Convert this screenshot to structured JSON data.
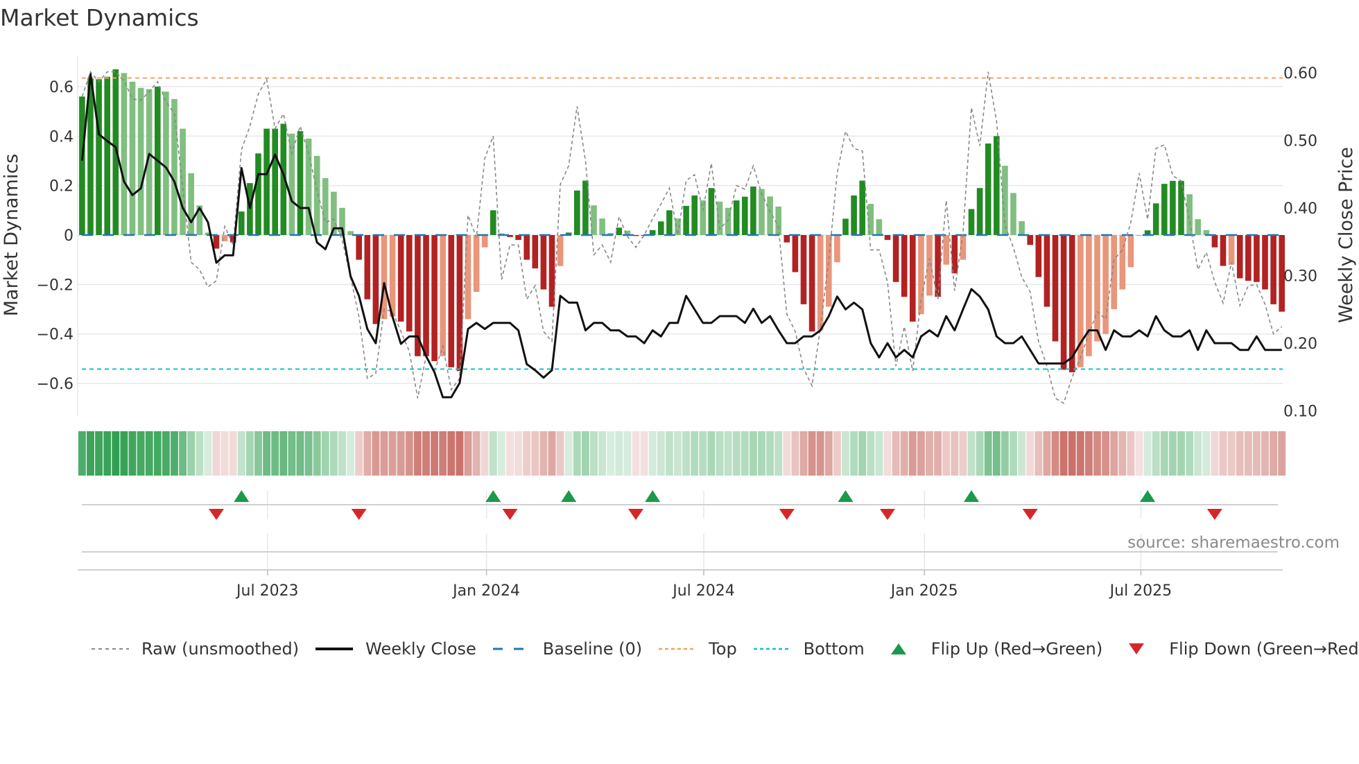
{
  "title": "Market Dynamics",
  "source": "source: sharemaestro.com",
  "colors": {
    "bar_green_strong": "#228b22",
    "bar_green_weak": "#80bf80",
    "bar_red_strong": "#b22222",
    "bar_red_weak": "#e9967a",
    "close": "#111111",
    "raw": "#888888",
    "baseline": "#1f77b4",
    "top": "#f4a261",
    "bottom": "#17becf",
    "flip_up": "#1a9a4a",
    "flip_down": "#d62728",
    "strip_green": "#2e9e4f",
    "strip_red": "#c0574e"
  },
  "legend": [
    {
      "key": "raw",
      "label": "Raw (unsmoothed)"
    },
    {
      "key": "close",
      "label": "Weekly Close"
    },
    {
      "key": "baseline",
      "label": "Baseline (0)"
    },
    {
      "key": "top",
      "label": "Top"
    },
    {
      "key": "bottom",
      "label": "Bottom"
    },
    {
      "key": "flip_up",
      "label": "Flip Up (Red→Green)"
    },
    {
      "key": "flip_down",
      "label": "Flip Down (Green→Red)"
    }
  ],
  "chart_data": {
    "type": "bar",
    "title": "Market Dynamics",
    "ylabel": "Market Dynamics",
    "ylabel_right": "Weekly Close Price",
    "x_unit": "week index",
    "ylim": [
      -0.75,
      0.72
    ],
    "ylim_right": [
      0.088,
      0.633
    ],
    "yticks": [
      {
        "v": -0.6,
        "label": "−0.6"
      },
      {
        "v": -0.4,
        "label": "−0.4"
      },
      {
        "v": -0.2,
        "label": "−0.2"
      },
      {
        "v": 0,
        "label": "0"
      },
      {
        "v": 0.2,
        "label": "0.2"
      },
      {
        "v": 0.4,
        "label": "0.4"
      },
      {
        "v": 0.6,
        "label": "0.6"
      }
    ],
    "yticks_right": [
      {
        "v": 0.1,
        "label": "0.10"
      },
      {
        "v": 0.2,
        "label": "0.20"
      },
      {
        "v": 0.3,
        "label": "0.30"
      },
      {
        "v": 0.4,
        "label": "0.40"
      },
      {
        "v": 0.5,
        "label": "0.50"
      },
      {
        "v": 0.6,
        "label": "0.60"
      }
    ],
    "xticks": [
      {
        "week": 22.1,
        "label": "Jul 2023"
      },
      {
        "week": 48.2,
        "label": "Jan 2024"
      },
      {
        "week": 74.1,
        "label": "Jul 2024"
      },
      {
        "week": 100.4,
        "label": "Jan 2025"
      },
      {
        "week": 126.2,
        "label": "Jul 2025"
      }
    ],
    "top_level": 0.635,
    "bottom_level": -0.542,
    "baseline": 0,
    "grid": true,
    "legend_position": "bottom",
    "dynamics": [
      0.56,
      0.635,
      0.63,
      0.64,
      0.67,
      0.655,
      0.62,
      0.595,
      0.59,
      0.6,
      0.58,
      0.55,
      0.43,
      0.25,
      0.12,
      0.01,
      -0.055,
      -0.025,
      -0.03,
      0.095,
      0.21,
      0.33,
      0.43,
      0.43,
      0.45,
      0.41,
      0.42,
      0.39,
      0.32,
      0.23,
      0.175,
      0.11,
      0.016,
      -0.1,
      -0.26,
      -0.36,
      -0.34,
      -0.33,
      -0.35,
      -0.39,
      -0.49,
      -0.49,
      -0.51,
      -0.49,
      -0.535,
      -0.55,
      -0.34,
      -0.23,
      -0.05,
      0.1,
      0.007,
      -0.008,
      -0.02,
      -0.1,
      -0.135,
      -0.22,
      -0.29,
      -0.125,
      0.01,
      0.18,
      0.22,
      0.12,
      0.067,
      0.008,
      0.03,
      0.018,
      -0.004,
      -0.003,
      0.02,
      0.055,
      0.1,
      0.067,
      0.118,
      0.16,
      0.14,
      0.19,
      0.135,
      0.11,
      0.14,
      0.155,
      0.196,
      0.186,
      0.156,
      0.115,
      -0.03,
      -0.15,
      -0.28,
      -0.39,
      -0.385,
      -0.29,
      -0.11,
      0.066,
      0.16,
      0.22,
      0.126,
      0.064,
      -0.02,
      -0.19,
      -0.25,
      -0.35,
      -0.32,
      -0.245,
      -0.25,
      -0.12,
      -0.155,
      -0.1,
      0.105,
      0.19,
      0.37,
      0.4,
      0.28,
      0.17,
      0.056,
      -0.04,
      -0.17,
      -0.29,
      -0.43,
      -0.545,
      -0.555,
      -0.535,
      -0.49,
      -0.43,
      -0.4,
      -0.3,
      -0.22,
      -0.13,
      -0.003,
      0.019,
      0.128,
      0.207,
      0.219,
      0.219,
      0.165,
      0.064,
      0.02,
      -0.05,
      -0.125,
      -0.12,
      -0.175,
      -0.185,
      -0.19,
      -0.22,
      -0.28,
      -0.31
    ],
    "strong": [
      1,
      1,
      1,
      1,
      1,
      0,
      0,
      0,
      0,
      1,
      0,
      0,
      0,
      0,
      0,
      0,
      1,
      0,
      1,
      1,
      1,
      1,
      1,
      1,
      1,
      0,
      1,
      0,
      0,
      0,
      0,
      0,
      0,
      1,
      1,
      1,
      0,
      0,
      1,
      1,
      1,
      1,
      1,
      0,
      1,
      1,
      0,
      0,
      0,
      1,
      0,
      1,
      1,
      1,
      1,
      1,
      1,
      0,
      1,
      1,
      1,
      0,
      0,
      0,
      1,
      0,
      1,
      1,
      1,
      1,
      1,
      0,
      1,
      1,
      0,
      1,
      0,
      0,
      1,
      1,
      1,
      0,
      0,
      0,
      1,
      1,
      1,
      1,
      0,
      0,
      0,
      1,
      1,
      1,
      0,
      0,
      1,
      1,
      1,
      1,
      0,
      0,
      1,
      0,
      1,
      0,
      1,
      1,
      1,
      1,
      0,
      0,
      0,
      1,
      1,
      1,
      1,
      1,
      1,
      0,
      0,
      0,
      0,
      0,
      0,
      0,
      0,
      1,
      1,
      1,
      1,
      1,
      0,
      0,
      0,
      1,
      1,
      0,
      1,
      1,
      1,
      1,
      1,
      1
    ],
    "raw": [
      0.56,
      0.66,
      0.62,
      0.66,
      0.66,
      0.625,
      0.55,
      0.545,
      0.58,
      0.62,
      0.54,
      0.49,
      0.19,
      -0.11,
      -0.14,
      -0.21,
      -0.185,
      0.035,
      -0.04,
      0.345,
      0.44,
      0.57,
      0.63,
      0.43,
      0.49,
      0.33,
      0.44,
      0.33,
      0.18,
      0.05,
      0.065,
      -0.02,
      -0.17,
      -0.33,
      -0.58,
      -0.56,
      -0.3,
      -0.31,
      -0.39,
      -0.47,
      -0.66,
      -0.49,
      -0.55,
      -0.45,
      -0.625,
      -0.58,
      0.08,
      -0.01,
      0.31,
      0.4,
      -0.18,
      -0.04,
      -0.04,
      -0.26,
      -0.205,
      -0.39,
      -0.43,
      0.205,
      0.28,
      0.52,
      0.3,
      -0.08,
      -0.04,
      -0.11,
      0.074,
      -0.006,
      -0.05,
      0.0,
      0.066,
      0.125,
      0.19,
      0.0,
      0.22,
      0.244,
      0.1,
      0.29,
      0.025,
      0.06,
      0.2,
      0.185,
      0.28,
      0.166,
      0.096,
      0.033,
      -0.32,
      -0.39,
      -0.54,
      -0.61,
      -0.375,
      -0.1,
      0.25,
      0.42,
      0.35,
      0.34,
      -0.06,
      -0.06,
      -0.19,
      -0.53,
      -0.37,
      -0.55,
      -0.26,
      -0.095,
      -0.26,
      0.14,
      -0.225,
      0.01,
      0.515,
      0.36,
      0.66,
      0.46,
      0.04,
      -0.05,
      -0.17,
      -0.23,
      -0.43,
      -0.53,
      -0.66,
      -0.68,
      -0.575,
      -0.495,
      -0.4,
      -0.31,
      -0.34,
      -0.1,
      -0.06,
      0.05,
      0.25,
      0.063,
      0.35,
      0.365,
      0.24,
      0.219,
      0.057,
      -0.14,
      -0.07,
      -0.19,
      -0.275,
      -0.11,
      -0.285,
      -0.205,
      -0.2,
      -0.28,
      -0.4,
      -0.37
    ],
    "weekly_close": [
      0.47,
      0.598,
      0.509,
      0.499,
      0.49,
      0.439,
      0.419,
      0.429,
      0.48,
      0.47,
      0.46,
      0.439,
      0.4,
      0.379,
      0.4,
      0.379,
      0.319,
      0.33,
      0.33,
      0.459,
      0.4,
      0.45,
      0.45,
      0.479,
      0.45,
      0.41,
      0.4,
      0.4,
      0.349,
      0.339,
      0.37,
      0.37,
      0.299,
      0.27,
      0.221,
      0.2,
      0.289,
      0.239,
      0.199,
      0.21,
      0.21,
      0.181,
      0.157,
      0.12,
      0.12,
      0.141,
      0.221,
      0.23,
      0.221,
      0.23,
      0.23,
      0.23,
      0.219,
      0.169,
      0.16,
      0.149,
      0.16,
      0.27,
      0.26,
      0.26,
      0.219,
      0.23,
      0.23,
      0.219,
      0.219,
      0.21,
      0.21,
      0.2,
      0.219,
      0.21,
      0.23,
      0.23,
      0.27,
      0.25,
      0.23,
      0.23,
      0.24,
      0.24,
      0.24,
      0.23,
      0.251,
      0.23,
      0.24,
      0.219,
      0.2,
      0.2,
      0.21,
      0.21,
      0.219,
      0.24,
      0.269,
      0.25,
      0.26,
      0.25,
      0.2,
      0.179,
      0.2,
      0.179,
      0.19,
      0.179,
      0.21,
      0.219,
      0.21,
      0.24,
      0.219,
      0.25,
      0.28,
      0.269,
      0.25,
      0.21,
      0.2,
      0.2,
      0.21,
      0.19,
      0.17,
      0.17,
      0.17,
      0.17,
      0.179,
      0.2,
      0.219,
      0.219,
      0.19,
      0.219,
      0.21,
      0.21,
      0.219,
      0.21,
      0.24,
      0.219,
      0.21,
      0.21,
      0.219,
      0.19,
      0.219,
      0.2,
      0.2,
      0.2,
      0.19,
      0.19,
      0.21,
      0.19,
      0.19,
      0.19
    ]
  }
}
